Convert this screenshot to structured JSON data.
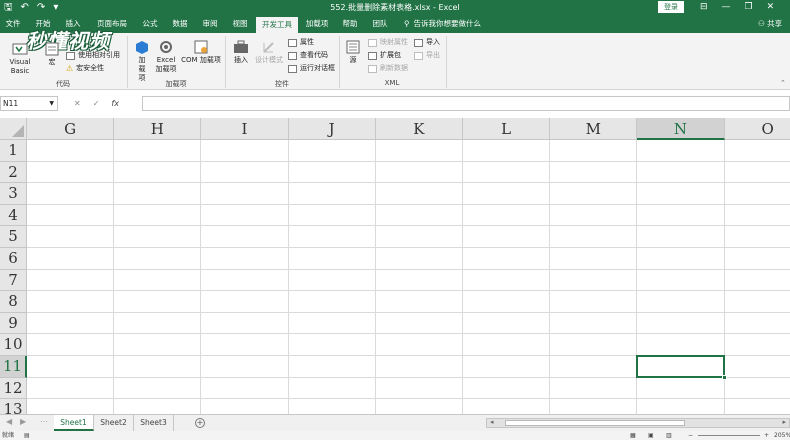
{
  "window": {
    "title": "552.批量删除素材表格.xlsx  -  Excel",
    "login_label": "登录",
    "qat": [
      "save-icon",
      "undo-icon",
      "redo-icon",
      "customize-icon"
    ]
  },
  "watermark": "秒懂视频",
  "tabs": [
    "文件",
    "开始",
    "插入",
    "页面布局",
    "公式",
    "数据",
    "审阅",
    "视图",
    "开发工具",
    "加载项",
    "帮助",
    "团队"
  ],
  "active_tab": "开发工具",
  "tell_me": "告诉我你想要做什么",
  "share": "共享",
  "ribbon": {
    "code_group": {
      "label": "代码",
      "visual_basic": "Visual Basic",
      "macros": "宏",
      "relative_refs": "使用相对引用",
      "macro_security": "宏安全性"
    },
    "addins_group": {
      "label": "加载项",
      "addins": "加载项",
      "excel_addins": "Excel 加载项",
      "com_addins": "COM 加载项"
    },
    "controls_group": {
      "label": "控件",
      "insert": "插入",
      "design_mode": "设计模式",
      "properties": "属性",
      "view_code": "查看代码",
      "run_dialog": "运行对话框"
    },
    "xml_group": {
      "label": "XML",
      "source": "源",
      "map_properties": "映射属性",
      "expansion_packs": "扩展包",
      "refresh_data": "刷新数据",
      "import": "导入",
      "export": "导出"
    }
  },
  "formula_bar": {
    "name_box": "N11",
    "formula": ""
  },
  "grid": {
    "columns": [
      "G",
      "H",
      "I",
      "J",
      "K",
      "L",
      "M",
      "N",
      "O"
    ],
    "rows": [
      "1",
      "2",
      "3",
      "4",
      "5",
      "6",
      "7",
      "8",
      "9",
      "10",
      "11",
      "12",
      "13"
    ],
    "selected_column": "N",
    "selected_row": "11"
  },
  "sheets": [
    "Sheet1",
    "Sheet2",
    "Sheet3"
  ],
  "active_sheet": "Sheet1",
  "status": {
    "ready": "就绪",
    "zoom": "205%"
  },
  "colors": {
    "accent": "#217346"
  }
}
